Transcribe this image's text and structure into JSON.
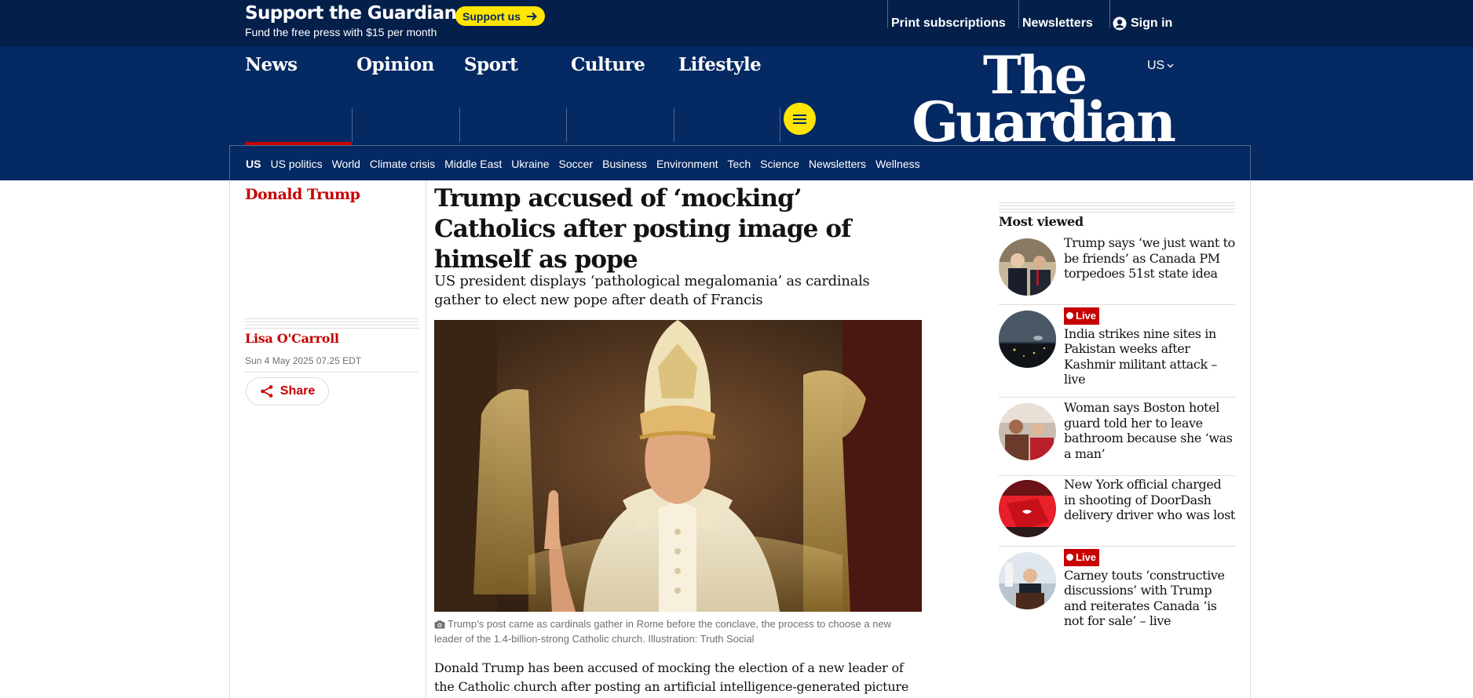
{
  "support": {
    "title": "Support the Guardian",
    "subtitle": "Fund the free press with $15 per month",
    "button_label": "Support us"
  },
  "topnav": {
    "print_subscriptions": "Print subscriptions",
    "newsletters": "Newsletters",
    "sign_in": "Sign in"
  },
  "masthead": {
    "edition": "US",
    "logo_line1": "The",
    "logo_line2": "Guardian"
  },
  "pillars": [
    "News",
    "Opinion",
    "Sport",
    "Culture",
    "Lifestyle"
  ],
  "subnav": [
    "US",
    "US politics",
    "World",
    "Climate crisis",
    "Middle East",
    "Ukraine",
    "Soccer",
    "Business",
    "Environment",
    "Tech",
    "Science",
    "Newsletters",
    "Wellness"
  ],
  "article": {
    "section": "Donald Trump",
    "headline": "Trump accused of ‘mocking’ Catholics after posting image of himself as pope",
    "standfirst": "US president displays ‘pathological megalomania’ as cardinals gather to elect new pope after death of Francis",
    "byline": "Lisa O'Carroll",
    "date": "Sun 4 May 2025 07.25 EDT",
    "share_label": "Share",
    "caption": "Trump’s post came as cardinals gather in Rome before the conclave, the process to choose a new leader of the 1.4-billion-strong Catholic church. Illustration: Truth Social",
    "body_start": "Donald Trump has been accused of mocking the election of a new leader of the Catholic church after posting an artificial intelligence-generated picture"
  },
  "most_viewed": {
    "title": "Most viewed",
    "live_label": "Live",
    "items": [
      {
        "text": "Trump says ‘we just want to be friends’ as Canada PM torpedoes 51st state idea",
        "live": false
      },
      {
        "text": "India strikes nine sites in Pakistan weeks after Kashmir militant attack – live",
        "live": true
      },
      {
        "text": "Woman says Boston hotel guard told her to leave bathroom because she ‘was a man’",
        "live": false
      },
      {
        "text": "New York official charged in shooting of DoorDash delivery driver who was lost",
        "live": false
      },
      {
        "text": "Carney touts ‘constructive discussions’ with Trump and reiterates Canada ‘is not for sale’ – live",
        "live": true
      }
    ]
  },
  "colors": {
    "brand_dark": "#041f4a",
    "brand": "#052962",
    "accent_yellow": "#ffe500",
    "news_red": "#c70000"
  }
}
